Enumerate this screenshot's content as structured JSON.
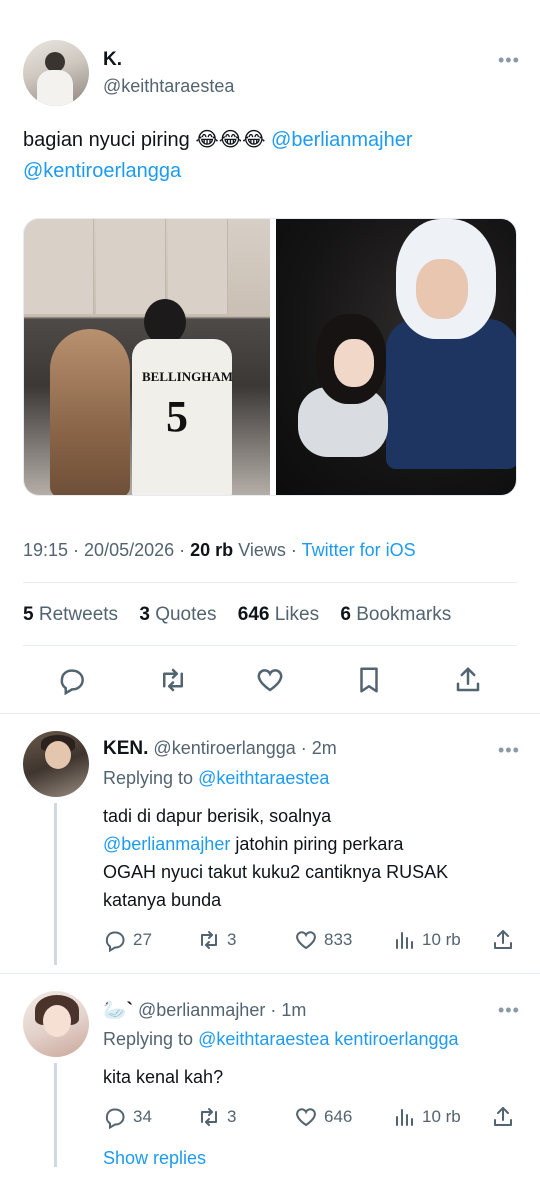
{
  "tweet": {
    "name": "K.",
    "handle": "@keithtaraestea",
    "text_plain": "bagian nyuci piring 😂😂😂",
    "mention_1": "@berlianmajher",
    "mention_2": "@kentiroerlangga",
    "media": {
      "left_jersey_name": "BELLINGHAM",
      "left_jersey_number": "5"
    },
    "time": "19:15",
    "date": "20/05/2026",
    "views_count": "20 rb",
    "views_label": "Views",
    "source": "Twitter for iOS",
    "stats": {
      "retweets_count": "5",
      "retweets_label": "Retweets",
      "quotes_count": "3",
      "quotes_label": "Quotes",
      "likes_count": "646",
      "likes_label": "Likes",
      "bookmarks_count": "6",
      "bookmarks_label": "Bookmarks"
    },
    "actions": [
      "reply-icon",
      "retweet-icon",
      "like-icon",
      "bookmark-icon",
      "share-icon"
    ]
  },
  "replies": [
    {
      "name": "KEN.",
      "handle": "@kentiroerlangga",
      "time": "2m",
      "replying_label": "Replying to",
      "replying_to": "@keithtaraestea",
      "text_1": "tadi di dapur berisik, soalnya",
      "text_mention": "@berlianmajher",
      "text_2": "jatohin piring perkara",
      "text_3": "OGAH nyuci takut kuku2 cantiknya RUSAK",
      "text_4": "katanya bunda",
      "replies": "27",
      "retweets": "3",
      "likes": "833",
      "views": "10 rb"
    },
    {
      "name": "🦢`",
      "handle": "@berlianmajher",
      "time": "1m",
      "replying_label": "Replying to",
      "replying_to": "@keithtaraestea kentiroerlangga",
      "text": "kita kenal kah?",
      "replies": "34",
      "retweets": "3",
      "likes": "646",
      "views": "10 rb"
    }
  ],
  "show_replies": "Show replies",
  "colors": {
    "accent": "#1d9bf0",
    "secondary_text": "#536471",
    "divider": "#e6ecf0"
  }
}
